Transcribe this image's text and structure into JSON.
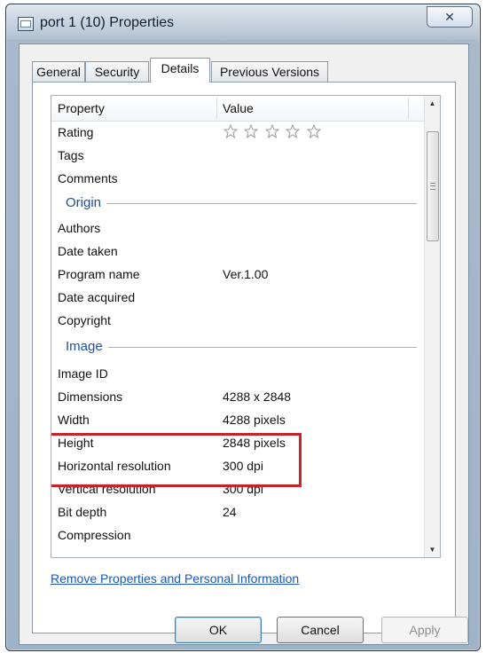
{
  "window": {
    "title": "port 1 (10) Properties",
    "close_glyph": "✕"
  },
  "tabs": [
    {
      "label": "General"
    },
    {
      "label": "Security"
    },
    {
      "label": "Details"
    },
    {
      "label": "Previous Versions"
    }
  ],
  "list": {
    "header": {
      "property": "Property",
      "value": "Value"
    },
    "rating": {
      "label": "Rating",
      "stars": 0,
      "max_stars": 5
    },
    "rows_top": [
      {
        "property": "Tags",
        "value": ""
      },
      {
        "property": "Comments",
        "value": ""
      }
    ],
    "group_origin": "Origin",
    "rows_origin": [
      {
        "property": "Authors",
        "value": ""
      },
      {
        "property": "Date taken",
        "value": ""
      },
      {
        "property": "Program name",
        "value": "Ver.1.00"
      },
      {
        "property": "Date acquired",
        "value": ""
      },
      {
        "property": "Copyright",
        "value": ""
      }
    ],
    "group_image": "Image",
    "rows_image": [
      {
        "property": "Image ID",
        "value": ""
      },
      {
        "property": "Dimensions",
        "value": "4288 x 2848"
      },
      {
        "property": "Width",
        "value": "4288 pixels"
      },
      {
        "property": "Height",
        "value": "2848 pixels"
      },
      {
        "property": "Horizontal resolution",
        "value": "300 dpi"
      },
      {
        "property": "Vertical resolution",
        "value": "300 dpi"
      },
      {
        "property": "Bit depth",
        "value": "24"
      },
      {
        "property": "Compression",
        "value": ""
      }
    ]
  },
  "link": {
    "label": "Remove Properties and Personal Information"
  },
  "buttons": {
    "ok": "OK",
    "cancel": "Cancel",
    "apply": "Apply"
  },
  "colors": {
    "highlight": "#c8232c",
    "group_text": "#1f4d99",
    "link": "#1a56b8"
  }
}
